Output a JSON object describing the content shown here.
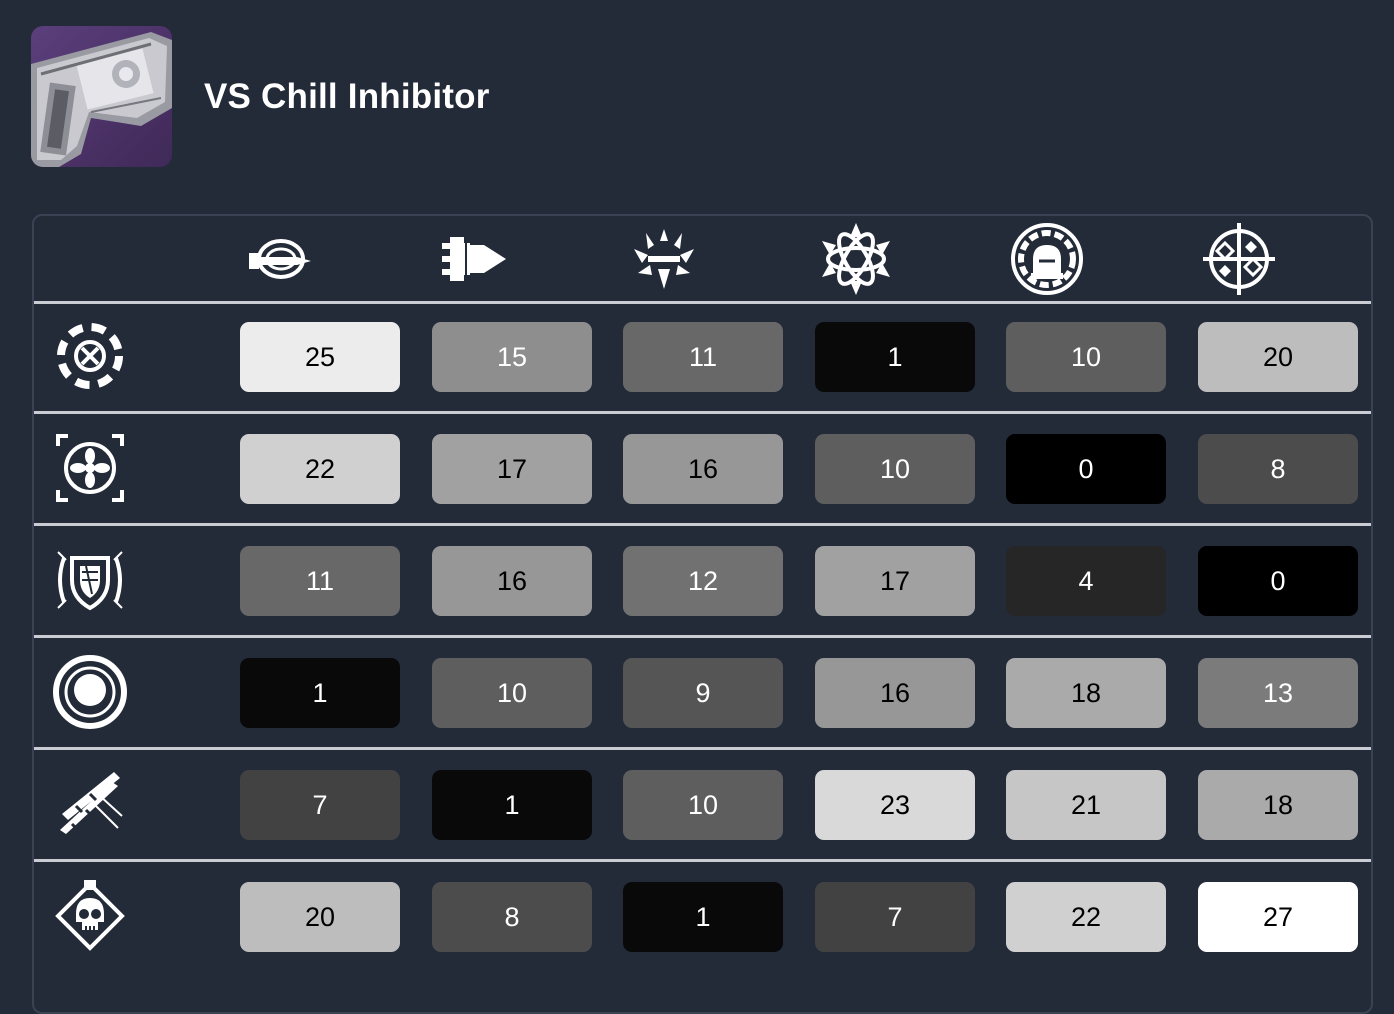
{
  "weapon": {
    "name": "VS Chill Inhibitor",
    "thumbnail_icon": "grenade-launcher-weapon-thumbnail"
  },
  "columns": [
    {
      "icon": "orb-arrow-icon"
    },
    {
      "icon": "bullet-stack-icon"
    },
    {
      "icon": "shield-arrow-burst-icon"
    },
    {
      "icon": "spiked-atom-icon"
    },
    {
      "icon": "gauge-dome-icon"
    },
    {
      "icon": "crosshair-diamond-icon"
    }
  ],
  "rows": [
    {
      "icon": "dashed-ring-target-icon",
      "values": [
        "25",
        "15",
        "11",
        "1",
        "10",
        "20"
      ]
    },
    {
      "icon": "fan-ring-bracket-icon",
      "values": [
        "22",
        "17",
        "16",
        "10",
        "0",
        "8"
      ]
    },
    {
      "icon": "crest-shield-icon",
      "values": [
        "11",
        "16",
        "12",
        "17",
        "4",
        "0"
      ]
    },
    {
      "icon": "ringed-dot-icon",
      "values": [
        "1",
        "10",
        "9",
        "16",
        "18",
        "13"
      ]
    },
    {
      "icon": "crossed-rifles-icon",
      "values": [
        "7",
        "1",
        "10",
        "23",
        "21",
        "18"
      ]
    },
    {
      "icon": "skull-diamond-icon",
      "values": [
        "20",
        "8",
        "1",
        "7",
        "22",
        "27"
      ]
    }
  ],
  "colors": {
    "background": "#232a38",
    "divider": "#c9ccd3",
    "scale_min": "#000000",
    "scale_max": "#ffffff",
    "value_max": 27
  }
}
